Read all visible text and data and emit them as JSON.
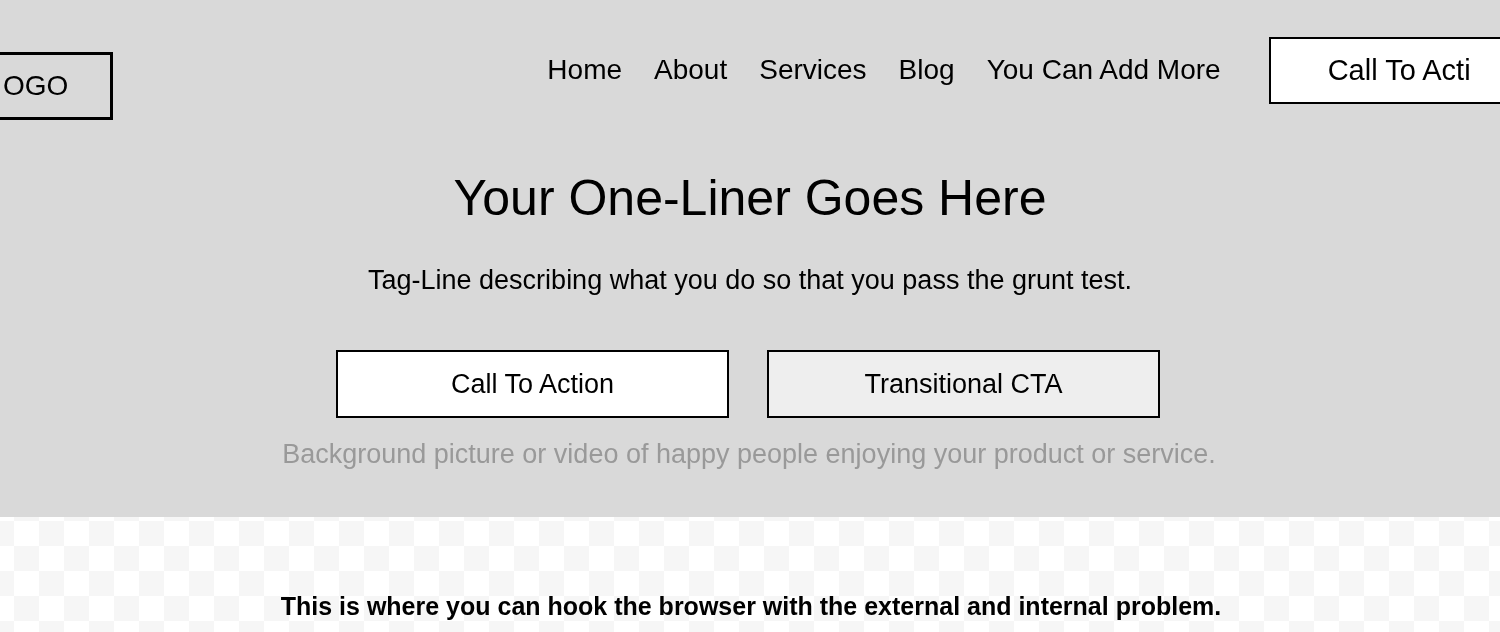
{
  "header": {
    "logo": "OGO",
    "nav": [
      {
        "label": "Home"
      },
      {
        "label": "About"
      },
      {
        "label": "Services"
      },
      {
        "label": "Blog"
      },
      {
        "label": "You Can Add More"
      }
    ],
    "cta": "Call To Acti"
  },
  "hero": {
    "headline": "Your One-Liner Goes Here",
    "tagline": "Tag-Line describing what you do so that you pass the grunt test.",
    "buttons": [
      {
        "label": "Call To Action",
        "kind": "primary"
      },
      {
        "label": "Transitional CTA",
        "kind": "secondary"
      }
    ],
    "note": "Background picture or video of happy people enjoying your product or service."
  },
  "problem": {
    "heading": "This is where you can hook the browser with the external and internal problem."
  }
}
